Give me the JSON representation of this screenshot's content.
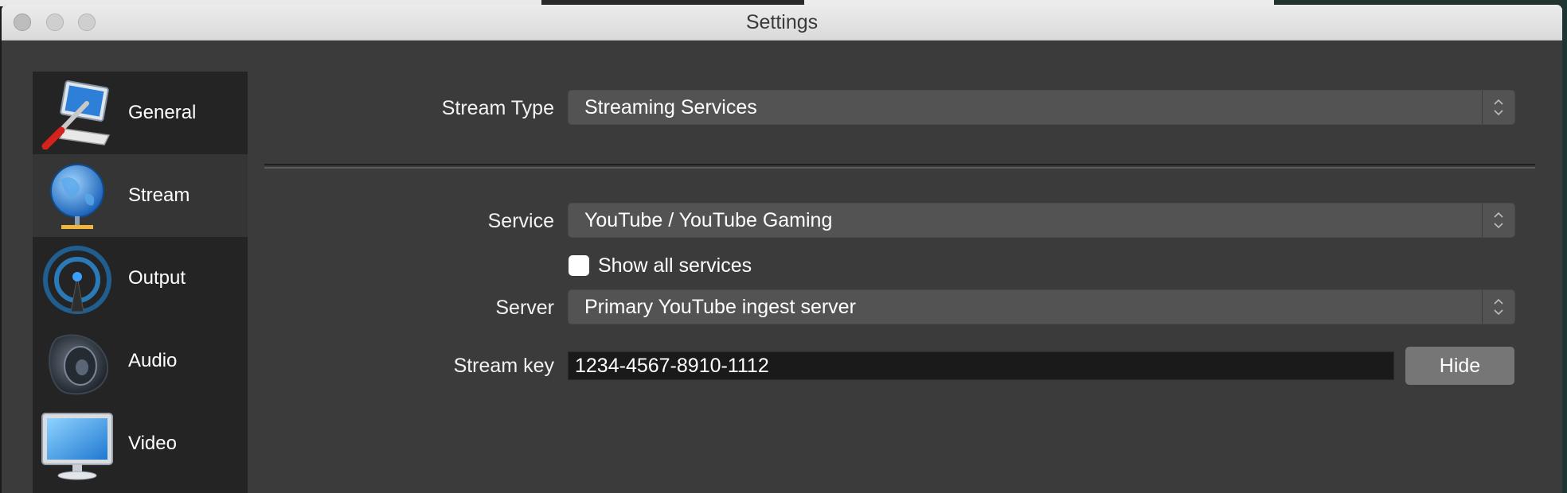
{
  "window": {
    "title": "Settings"
  },
  "sidebar": {
    "items": [
      {
        "label": "General",
        "icon": "general-tools-icon"
      },
      {
        "label": "Stream",
        "icon": "stream-globe-icon",
        "active": true
      },
      {
        "label": "Output",
        "icon": "output-broadcast-icon"
      },
      {
        "label": "Audio",
        "icon": "audio-speaker-icon"
      },
      {
        "label": "Video",
        "icon": "video-monitor-icon"
      }
    ]
  },
  "stream": {
    "stream_type_label": "Stream Type",
    "stream_type_value": "Streaming Services",
    "service_label": "Service",
    "service_value": "YouTube / YouTube Gaming",
    "show_all_label": "Show all services",
    "show_all_checked": false,
    "server_label": "Server",
    "server_value": "Primary YouTube ingest server",
    "key_label": "Stream key",
    "key_value": "1234-4567-8910-1112",
    "hide_button": "Hide"
  },
  "colors": {
    "window_bg": "#3b3b3b",
    "sidebar_bg": "#242424",
    "select_bg": "#535353",
    "button_bg": "#767676"
  }
}
